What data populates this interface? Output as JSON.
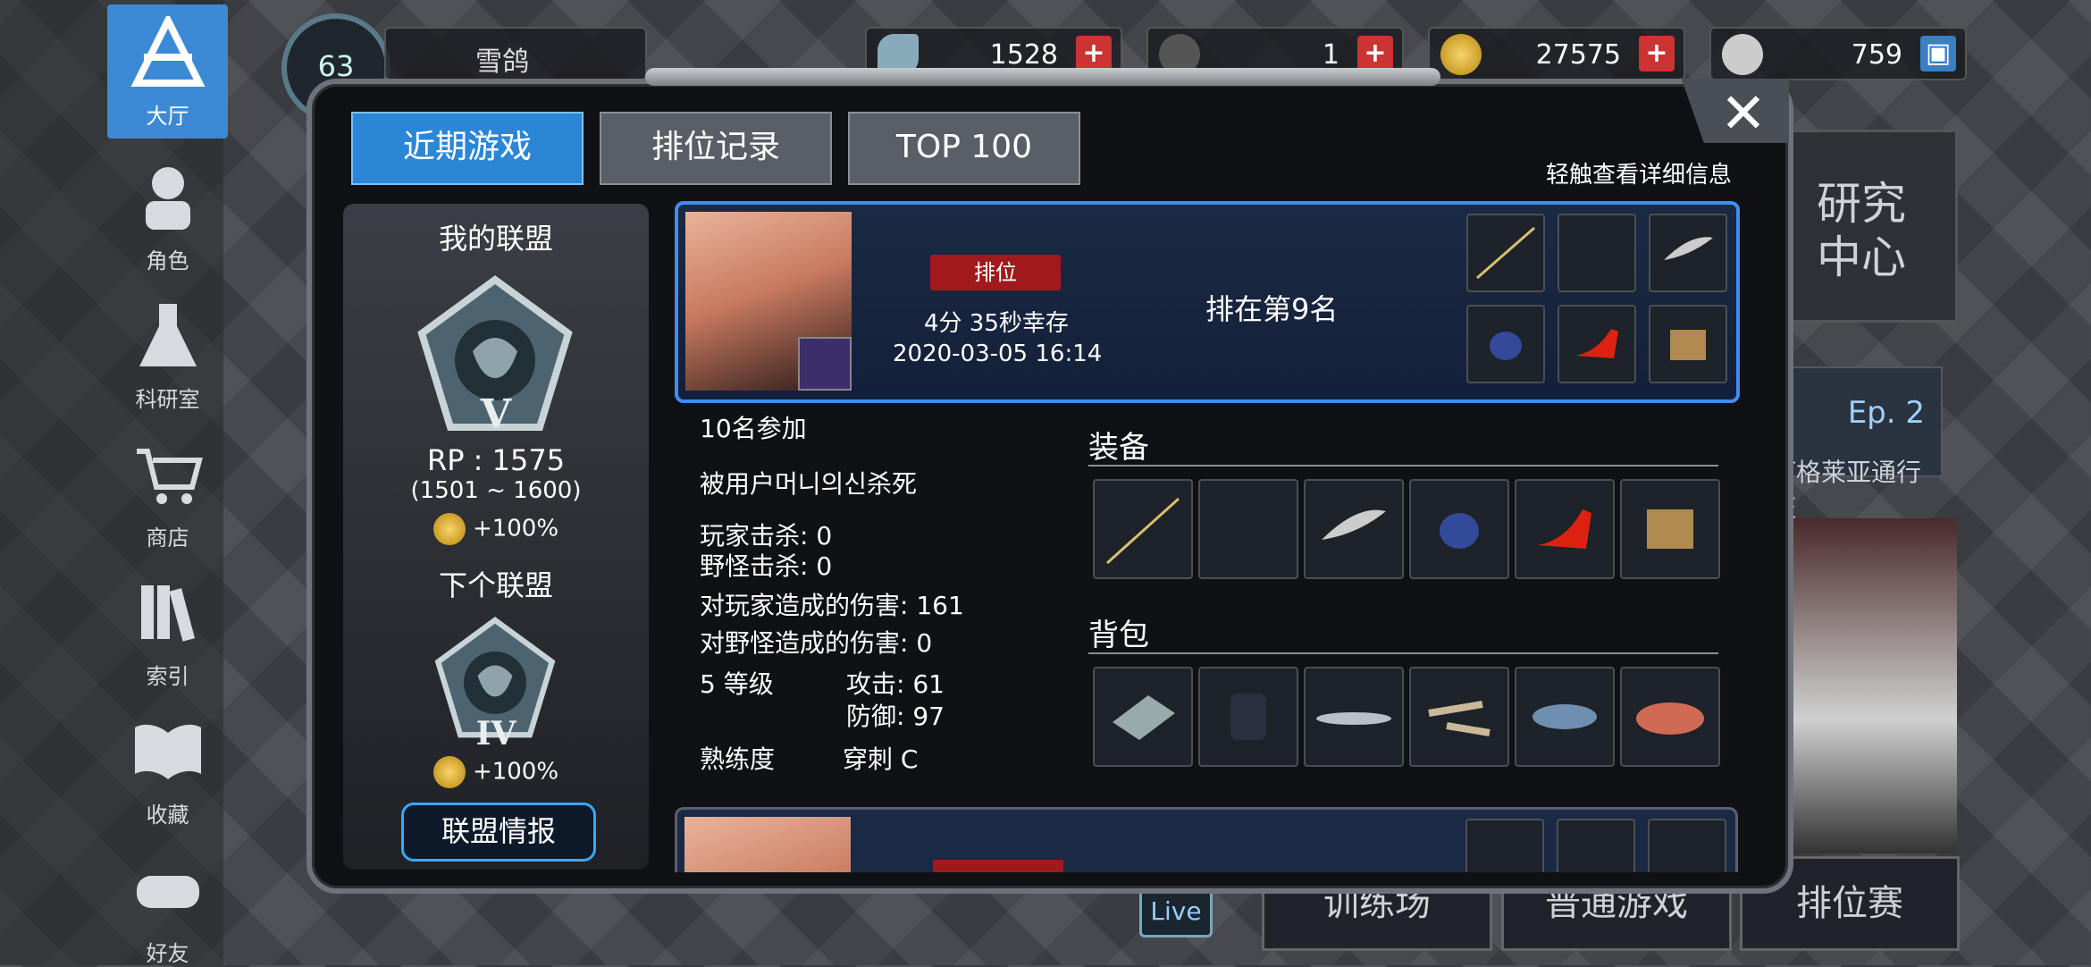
{
  "nav": {
    "items": [
      {
        "label": "大厅",
        "icon": "lobby-icon"
      },
      {
        "label": "角色",
        "icon": "character-icon"
      },
      {
        "label": "科研室",
        "icon": "lab-flask-icon"
      },
      {
        "label": "商店",
        "icon": "shop-cart-icon"
      },
      {
        "label": "索引",
        "icon": "index-books-icon"
      },
      {
        "label": "收藏",
        "icon": "collection-book-icon"
      },
      {
        "label": "好友",
        "icon": "friends-gamepad-icon"
      }
    ]
  },
  "profile": {
    "level": "63",
    "name": "雪鸽"
  },
  "resources": [
    {
      "icon": "crystal-icon",
      "value": "1528"
    },
    {
      "icon": "ticket-icon",
      "value": "1"
    },
    {
      "icon": "gold-coin-icon",
      "value": "27575"
    },
    {
      "icon": "bp-icon",
      "value": "759"
    }
  ],
  "tabs": [
    "近期游戏",
    "排位记录",
    "TOP 100"
  ],
  "hint": "轻触查看详细信息",
  "league": {
    "my_title": "我的联盟",
    "my_tier": "V",
    "rp": "RP : 1575",
    "range": "(1501 ~ 1600)",
    "my_bonus": "+100%",
    "next_title": "下个联盟",
    "next_tier": "IV",
    "next_bonus": "+100%",
    "info_button": "联盟情报"
  },
  "record": {
    "mode_badge": "排位",
    "survival": "4分 35秒幸存",
    "datetime": "2020-03-05 16:14",
    "placement": "排在第9名",
    "participants": "10名参加",
    "killed_by": "被用户머니의신杀死",
    "player_kills": "玩家击杀: 0",
    "monster_kills": "野怪击杀: 0",
    "player_damage": "对玩家造成的伤害: 161",
    "monster_damage": "对野怪造成的伤害: 0",
    "level": "5 等级",
    "attack": "攻击: 61",
    "defense": "防御: 97",
    "mastery_label": "熟练度",
    "mastery_value": "穿刺 C",
    "equipment_title": "装备",
    "backpack_title": "背包",
    "equipment": [
      "rapier-item",
      "empty-slot",
      "feather-item",
      "helmet-item",
      "red-heel-item",
      "crate-item"
    ],
    "backpack": [
      "metal-plate-item",
      "dark-armor-item",
      "saury-fish-item",
      "branches-item",
      "tuna-item",
      "raw-meat-item"
    ]
  },
  "background": {
    "research_center": "研究\n中心",
    "episode": "Ep. 2",
    "pass_label": "阿格莱亚通行证",
    "live": "Live",
    "training": "训练场",
    "normal_game": "普通游戏",
    "ranked_game": "排位赛"
  },
  "colors": {
    "accent_blue": "#2b86d6",
    "rank_red": "#a01a1c",
    "plus_red": "#cc3333",
    "card_border": "#3f8ef0"
  }
}
